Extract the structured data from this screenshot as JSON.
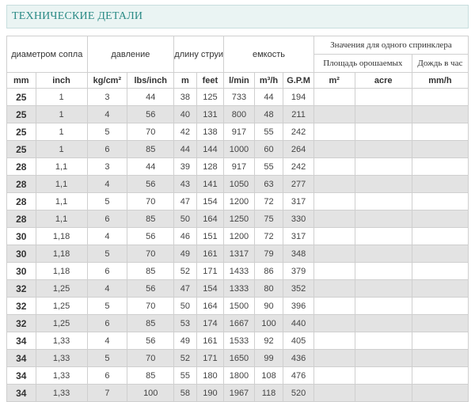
{
  "title": "ТЕХНИЧЕСКИЕ ДЕТАЛИ",
  "header": {
    "nozzle_diameter": "диаметром сопла",
    "pressure": "давление",
    "jet_length": "длину струи",
    "capacity": "емкость",
    "per_sprinkler": "Значения для одного спринклера",
    "irrigated_area": "Площадь орошаемых",
    "rain_per_hour": "Дождь в час"
  },
  "units": [
    "mm",
    "inch",
    "kg/cm²",
    "lbs/inch",
    "m",
    "feet",
    "l/min",
    "m³/h",
    "G.P.M",
    "m²",
    "acre",
    "mm/h"
  ],
  "rows": [
    [
      "25",
      "1",
      "3",
      "44",
      "38",
      "125",
      "733",
      "44",
      "194"
    ],
    [
      "25",
      "1",
      "4",
      "56",
      "40",
      "131",
      "800",
      "48",
      "211"
    ],
    [
      "25",
      "1",
      "5",
      "70",
      "42",
      "138",
      "917",
      "55",
      "242"
    ],
    [
      "25",
      "1",
      "6",
      "85",
      "44",
      "144",
      "1000",
      "60",
      "264"
    ],
    [
      "28",
      "1,1",
      "3",
      "44",
      "39",
      "128",
      "917",
      "55",
      "242"
    ],
    [
      "28",
      "1,1",
      "4",
      "56",
      "43",
      "141",
      "1050",
      "63",
      "277"
    ],
    [
      "28",
      "1,1",
      "5",
      "70",
      "47",
      "154",
      "1200",
      "72",
      "317"
    ],
    [
      "28",
      "1,1",
      "6",
      "85",
      "50",
      "164",
      "1250",
      "75",
      "330"
    ],
    [
      "30",
      "1,18",
      "4",
      "56",
      "46",
      "151",
      "1200",
      "72",
      "317"
    ],
    [
      "30",
      "1,18",
      "5",
      "70",
      "49",
      "161",
      "1317",
      "79",
      "348"
    ],
    [
      "30",
      "1,18",
      "6",
      "85",
      "52",
      "171",
      "1433",
      "86",
      "379"
    ],
    [
      "32",
      "1,25",
      "4",
      "56",
      "47",
      "154",
      "1333",
      "80",
      "352"
    ],
    [
      "32",
      "1,25",
      "5",
      "70",
      "50",
      "164",
      "1500",
      "90",
      "396"
    ],
    [
      "32",
      "1,25",
      "6",
      "85",
      "53",
      "174",
      "1667",
      "100",
      "440"
    ],
    [
      "34",
      "1,33",
      "4",
      "56",
      "49",
      "161",
      "1533",
      "92",
      "405"
    ],
    [
      "34",
      "1,33",
      "5",
      "70",
      "52",
      "171",
      "1650",
      "99",
      "436"
    ],
    [
      "34",
      "1,33",
      "6",
      "85",
      "55",
      "180",
      "1800",
      "108",
      "476"
    ],
    [
      "34",
      "1,33",
      "7",
      "100",
      "58",
      "190",
      "1967",
      "118",
      "520"
    ]
  ]
}
